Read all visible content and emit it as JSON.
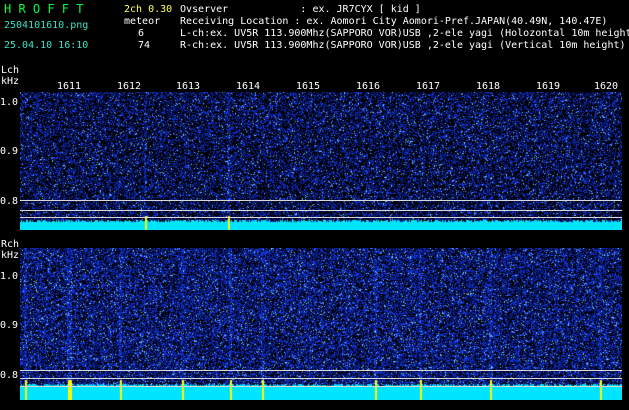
{
  "header": {
    "app_name": "H R O F F T",
    "filename": "2504101610.png",
    "datetime": "25.04.10 16:10",
    "mode": "2ch 0.30",
    "meteor_label": "meteor",
    "meteor_lch": "6",
    "meteor_rch": "74",
    "observer_line": "Ovserver            : ex. JR7CYX [ kid ]",
    "location_line": "Receiving Location : ex. Aomori City Aomori-Pref.JAPAN(40.49N, 140.47E)",
    "lch_line": "L-ch:ex. UV5R 113.900Mhz(SAPPORO VOR)USB ,2-ele yagi (Holozontal 10m height)",
    "rch_line": "R-ch:ex. UV5R 113.900Mhz(SAPPORO VOR)USB ,2-ele yagi (Vertical 10m height)"
  },
  "lch": {
    "label": "Lch",
    "unit": "kHz",
    "yticks": [
      "1.0",
      "0.9",
      "0.8"
    ]
  },
  "rch": {
    "label": "Rch",
    "unit": "kHz",
    "yticks": [
      "1.0",
      "0.9",
      "0.8"
    ]
  },
  "time_axis": {
    "ticks": [
      "1611",
      "1612",
      "1613",
      "1614",
      "1615",
      "1616",
      "1617",
      "1618",
      "1619",
      "1620"
    ]
  },
  "colors": {
    "background": "#000000",
    "noise_blue": "#1e3cff",
    "baseline_cyan": "#00e5ff",
    "meteor_yellow": "#ffff00",
    "title_green": "#00ff3c"
  }
}
